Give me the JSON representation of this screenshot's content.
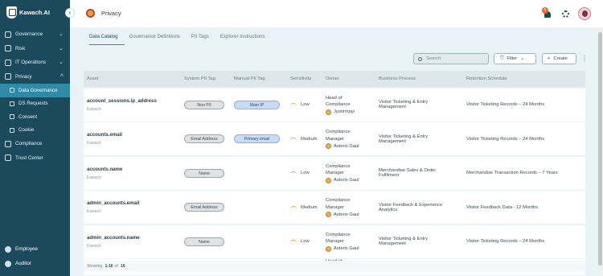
{
  "app": {
    "logo_text": "Kawach.AI",
    "collapse_icon": "chevron-left-icon"
  },
  "sidebar": {
    "items": [
      {
        "label": "Governance",
        "icon": "governance-icon",
        "expanded": false
      },
      {
        "label": "Risk",
        "icon": "risk-icon",
        "expanded": false
      },
      {
        "label": "IT Operations",
        "icon": "it-operations-icon",
        "expanded": false
      },
      {
        "label": "Privacy",
        "icon": "privacy-icon",
        "expanded": true
      }
    ],
    "privacy_sub": [
      {
        "label": "Data Governance",
        "icon": "data-governance-icon",
        "active": true
      },
      {
        "label": "DS Requests",
        "icon": "ds-requests-icon"
      },
      {
        "label": "Consent",
        "icon": "consent-icon"
      },
      {
        "label": "Cookie",
        "icon": "cookie-icon"
      }
    ],
    "items_after": [
      {
        "label": "Compliance",
        "icon": "compliance-icon"
      },
      {
        "label": "Trust Center",
        "icon": "trust-center-icon"
      }
    ],
    "bottom": [
      {
        "label": "Employee",
        "icon": "employee-icon"
      },
      {
        "label": "Auditor",
        "icon": "auditor-icon"
      }
    ]
  },
  "header": {
    "title": "Privacy",
    "notification_count": "5"
  },
  "tabs": [
    {
      "label": "Data Catalog",
      "active": true
    },
    {
      "label": "Governance Definitions"
    },
    {
      "label": "PII Tags"
    },
    {
      "label": "Explorer Instructions"
    }
  ],
  "toolbar": {
    "search_placeholder": "Search",
    "filter_label": "Filter",
    "create_label": "Create"
  },
  "table": {
    "columns": [
      "Asset",
      "System PII Tag",
      "Manual PII Tag",
      "Sensitivity",
      "Owner",
      "Business Process",
      "Retention Schedule"
    ],
    "rows": [
      {
        "asset": "account_sessions.ip_address",
        "source": "Kawach",
        "system_tag": "Non PII",
        "manual_tag": "Main IP",
        "sensitivity": "Low",
        "owner_role_1": "Head of",
        "owner_role_2": "Compliance",
        "owner_name": "Jyotirmayi",
        "process_1": "Visitor Ticketing & Entry",
        "process_2": "Management",
        "retention": "Visitor Ticketing Records – 24 Months"
      },
      {
        "asset": "accounts.email",
        "source": "Kawach",
        "system_tag": "Email Address",
        "manual_tag": "Primary email",
        "sensitivity": "Medium",
        "owner_role_1": "Compliance",
        "owner_role_2": "Manager",
        "owner_name": "Asterix Gaul",
        "process_1": "Visitor Ticketing & Entry",
        "process_2": "Management",
        "retention": "Visitor Ticketing Records – 24 Months"
      },
      {
        "asset": "accounts.name",
        "source": "Kawach",
        "system_tag": "Name",
        "manual_tag": "",
        "sensitivity": "Low",
        "owner_role_1": "Compliance",
        "owner_role_2": "Manager",
        "owner_name": "Asterix Gaul",
        "process_1": "Merchandise Sales & Order",
        "process_2": "Fulfilment",
        "retention": "Merchandise Transaction Records – 7 Years"
      },
      {
        "asset": "admin_accounts.email",
        "source": "Kawach",
        "system_tag": "Email Address",
        "manual_tag": "",
        "sensitivity": "Medium",
        "owner_role_1": "Compliance",
        "owner_role_2": "Manager",
        "owner_name": "Asterix Gaul",
        "process_1": "Visitor Feedback & Experience",
        "process_2": "Analytics",
        "retention": "Visitor Feedback Data - 12 Months"
      },
      {
        "asset": "admin_accounts.name",
        "source": "Kawach",
        "system_tag": "Name",
        "manual_tag": "",
        "sensitivity": "Low",
        "owner_role_1": "Compliance",
        "owner_role_2": "Manager",
        "owner_name": "Asterix Gaul",
        "process_1": "Visitor Ticketing & Entry",
        "process_2": "Management",
        "retention": "Visitor Ticketing Records – 24 Months"
      }
    ],
    "partial_row_owner": "Head of"
  },
  "footer": {
    "prefix": "Showing",
    "range": "1-16",
    "of": "of",
    "total": "16"
  },
  "colors": {
    "sidebar": "#1a4a5c",
    "active": "#2f8aa8",
    "content_bg": "#e9f3f7",
    "sensitivity": "#e3a83a"
  }
}
